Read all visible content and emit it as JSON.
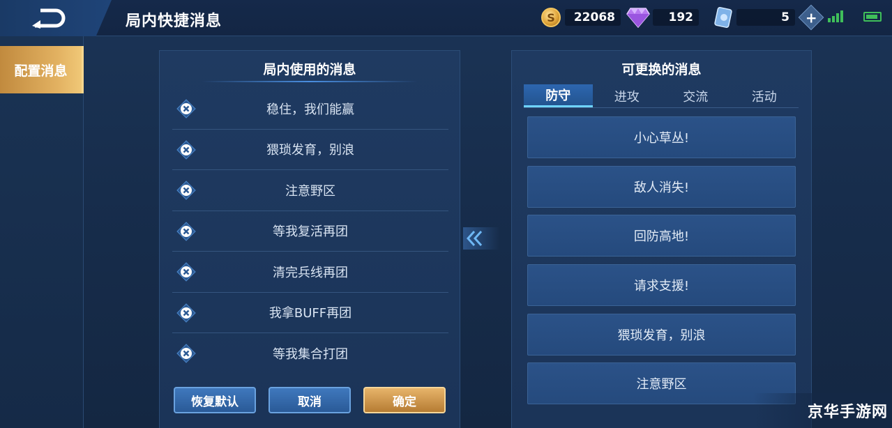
{
  "header": {
    "title": "局内快捷消息",
    "gold": "22068",
    "diamonds": "192",
    "tickets": "5",
    "coin_symbol": "S"
  },
  "sidebar": {
    "items": [
      {
        "label": "配置消息",
        "active": true
      }
    ]
  },
  "left_panel": {
    "title": "局内使用的消息",
    "messages": [
      "稳住，我们能赢",
      "猥琐发育，别浪",
      "注意野区",
      "等我复活再团",
      "清完兵线再团",
      "我拿BUFF再团",
      "等我集合打团"
    ],
    "buttons": {
      "reset": "恢复默认",
      "cancel": "取消",
      "confirm": "确定"
    }
  },
  "right_panel": {
    "title": "可更换的消息",
    "tabs": [
      "防守",
      "进攻",
      "交流",
      "活动"
    ],
    "active_tab": 0,
    "options": [
      "小心草丛!",
      "敌人消失!",
      "回防高地!",
      "请求支援!",
      "猥琐发育，别浪",
      "注意野区"
    ]
  },
  "watermark": "京华手游网",
  "colors": {
    "accent_gold": "#e2b161",
    "accent_blue": "#2d66b0",
    "signal": "#3fbf5a"
  }
}
